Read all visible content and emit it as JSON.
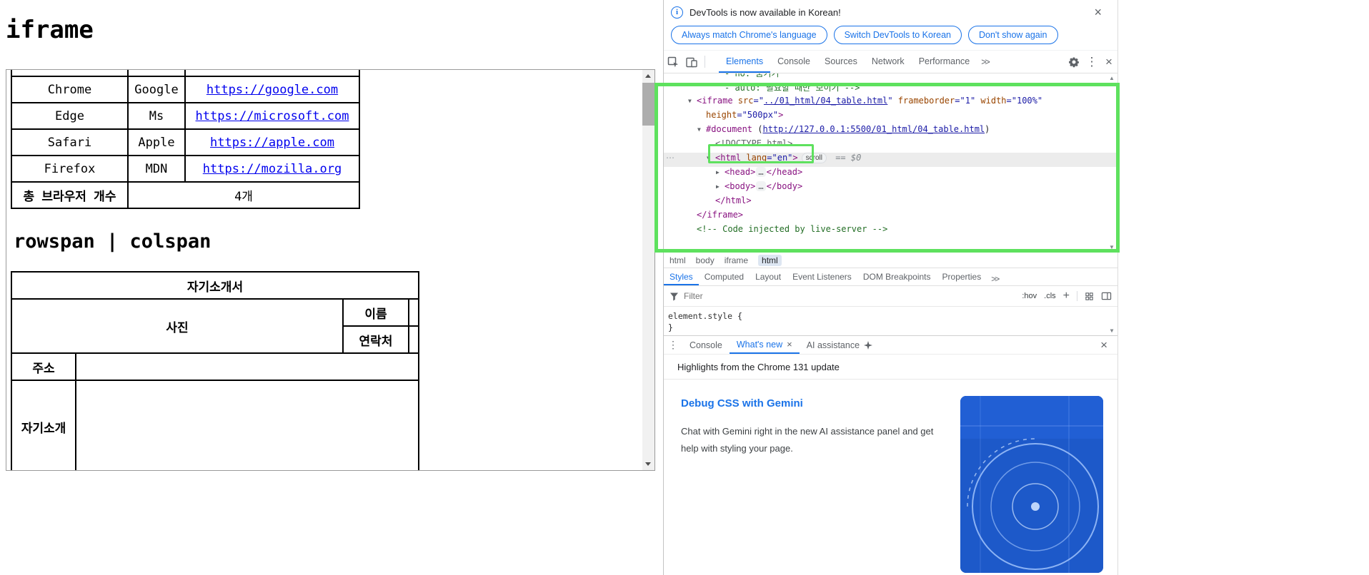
{
  "page": {
    "title": "iframe",
    "section_heading": "rowspan | colspan",
    "browser_table": {
      "rows": [
        {
          "name": "Chrome",
          "maker": "Google",
          "url": "https://google.com"
        },
        {
          "name": "Edge",
          "maker": "Ms",
          "url": "https://microsoft.com"
        },
        {
          "name": "Safari",
          "maker": "Apple",
          "url": "https://apple.com"
        },
        {
          "name": "Firefox",
          "maker": "MDN",
          "url": "https://mozilla.org"
        }
      ],
      "summary_label": "총 브라우저 개수",
      "summary_value": "4개"
    },
    "profile_table": {
      "title": "자기소개서",
      "photo_label": "사진",
      "name_label": "이름",
      "contact_label": "연락처",
      "address_label": "주소",
      "intro_label": "자기소개"
    }
  },
  "devtools": {
    "icons": {
      "close": "×",
      "kebab": "⋮",
      "ellipsis": "⋯",
      "up": "▲",
      "down": "▼",
      "plus": "+",
      "info": "i"
    },
    "banner": {
      "message": "DevTools is now available in Korean!",
      "buttons": [
        "Always match Chrome's language",
        "Switch DevTools to Korean",
        "Don't show again"
      ]
    },
    "main_tabs": [
      "Elements",
      "Console",
      "Sources",
      "Network",
      "Performance"
    ],
    "active_tab": "Elements",
    "more_tabs": ">>",
    "elements_tree": {
      "lines": [
        {
          "indent": 3,
          "cut": true,
          "tokens": [
            {
              "t": "- no: 숨기기",
              "y": "comment"
            }
          ]
        },
        {
          "indent": 3,
          "tokens": [
            {
              "t": "- auto: 필요할 때만 보이기 -->",
              "y": "comment"
            }
          ]
        },
        {
          "indent": 0,
          "arrow": "▼",
          "tokens": [
            {
              "t": "<iframe ",
              "y": "tag"
            },
            {
              "t": "src",
              "y": "attr"
            },
            {
              "t": "=\"",
              "y": "value"
            },
            {
              "t": "../01_html/04_table.html",
              "y": "link"
            },
            {
              "t": "\" ",
              "y": "value"
            },
            {
              "t": "frameborder",
              "y": "attr"
            },
            {
              "t": "=\"1\" ",
              "y": "value"
            },
            {
              "t": "width",
              "y": "attr"
            },
            {
              "t": "=\"100%\"",
              "y": "value"
            }
          ]
        },
        {
          "indent": 1,
          "tokens": [
            {
              "t": "height",
              "y": "attr"
            },
            {
              "t": "=\"500px\"",
              "y": "value"
            },
            {
              "t": ">",
              "y": "tag"
            }
          ]
        },
        {
          "indent": 1,
          "arrow": "▼",
          "tokens": [
            {
              "t": "#document",
              "y": "doc"
            },
            {
              "t": " (",
              "y": "plain"
            },
            {
              "t": "http://127.0.0.1:5500/01_html/04_table.html",
              "y": "link"
            },
            {
              "t": ")",
              "y": "plain"
            }
          ]
        },
        {
          "indent": 2,
          "tokens": [
            {
              "t": "<!DOCTYPE html>",
              "y": "doctype"
            }
          ]
        },
        {
          "indent": 2,
          "arrow": "▼",
          "selected": true,
          "gutter": "⋯",
          "tokens": [
            {
              "t": "<html ",
              "y": "tag"
            },
            {
              "t": "lang",
              "y": "attr"
            },
            {
              "t": "=\"en\"",
              "y": "value"
            },
            {
              "t": ">",
              "y": "tag"
            },
            {
              "t": "scroll",
              "y": "badge"
            },
            {
              "t": " == $0",
              "y": "meta"
            }
          ]
        },
        {
          "indent": 3,
          "arrow": "▶",
          "tokens": [
            {
              "t": "<head>",
              "y": "tag"
            },
            {
              "t": "…",
              "y": "dots"
            },
            {
              "t": "</head>",
              "y": "tag"
            }
          ]
        },
        {
          "indent": 3,
          "arrow": "▶",
          "tokens": [
            {
              "t": "<body>",
              "y": "tag"
            },
            {
              "t": "…",
              "y": "dots"
            },
            {
              "t": "</body>",
              "y": "tag"
            }
          ]
        },
        {
          "indent": 2,
          "tokens": [
            {
              "t": "</html>",
              "y": "tag"
            }
          ]
        },
        {
          "indent": 0,
          "tokens": [
            {
              "t": "</iframe>",
              "y": "tag"
            }
          ]
        },
        {
          "indent": 0,
          "tokens": [
            {
              "t": "<!-- Code injected by live-server -->",
              "y": "comment"
            }
          ]
        }
      ]
    },
    "breadcrumbs": [
      "html",
      "body",
      "iframe",
      "html"
    ],
    "styles_tabs": [
      "Styles",
      "Computed",
      "Layout",
      "Event Listeners",
      "DOM Breakpoints",
      "Properties"
    ],
    "styles_active": "Styles",
    "styles_more": ">>",
    "filter": {
      "placeholder": "Filter",
      "hov": ":hov",
      "cls": ".cls"
    },
    "css_rule": {
      "selector": "element.style",
      "open": " {",
      "close": "}"
    },
    "drawer": {
      "tabs": [
        "Console",
        "What's new",
        "AI assistance"
      ],
      "active": "What's new",
      "heading": "Highlights from the Chrome 131 update",
      "card_title": "Debug CSS with Gemini",
      "card_body": "Chat with Gemini right in the new AI assistance panel and get help with styling your page."
    }
  }
}
